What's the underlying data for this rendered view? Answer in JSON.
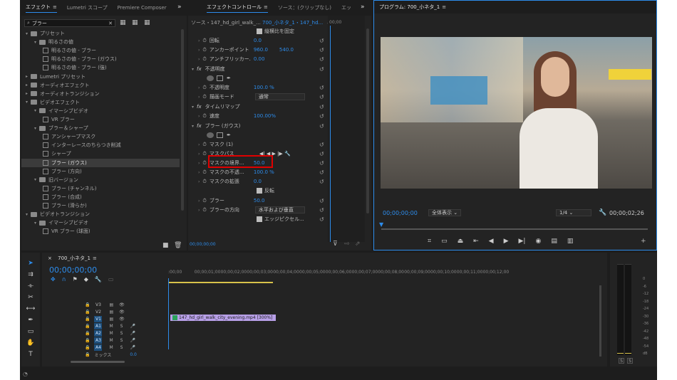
{
  "effects_panel": {
    "tab": "エフェクト",
    "tab2": "Lumetri スコープ",
    "tab3": "Premiere Composer",
    "search": "ブラー",
    "tree": [
      {
        "label": "プリセット",
        "lvl": 0,
        "type": "folder",
        "open": true
      },
      {
        "label": "明るさの値",
        "lvl": 1,
        "type": "folder",
        "open": true
      },
      {
        "label": "明るさの値 - ブラー",
        "lvl": 2,
        "type": "fx"
      },
      {
        "label": "明るさの値 - ブラー (ガウス)",
        "lvl": 2,
        "type": "fx"
      },
      {
        "label": "明るさの値 - ブラー (強)",
        "lvl": 2,
        "type": "fx"
      },
      {
        "label": "Lumetri プリセット",
        "lvl": 0,
        "type": "folder",
        "open": false
      },
      {
        "label": "オーディオエフェクト",
        "lvl": 0,
        "type": "folder",
        "open": false
      },
      {
        "label": "オーディオトランジション",
        "lvl": 0,
        "type": "folder",
        "open": false
      },
      {
        "label": "ビデオエフェクト",
        "lvl": 0,
        "type": "folder",
        "open": true
      },
      {
        "label": "イマーシブビデオ",
        "lvl": 1,
        "type": "folder",
        "open": true
      },
      {
        "label": "VR ブラー",
        "lvl": 2,
        "type": "fx"
      },
      {
        "label": "ブラー＆シャープ",
        "lvl": 1,
        "type": "folder",
        "open": true
      },
      {
        "label": "アンシャープマスク",
        "lvl": 2,
        "type": "fx"
      },
      {
        "label": "インターレースのちらつき削減",
        "lvl": 2,
        "type": "fx"
      },
      {
        "label": "シャープ",
        "lvl": 2,
        "type": "fx"
      },
      {
        "label": "ブラー (ガウス)",
        "lvl": 2,
        "type": "fx",
        "selected": true
      },
      {
        "label": "ブラー (方向)",
        "lvl": 2,
        "type": "fx"
      },
      {
        "label": "旧バージョン",
        "lvl": 1,
        "type": "folder",
        "open": true
      },
      {
        "label": "ブラー (チャンネル)",
        "lvl": 2,
        "type": "fx"
      },
      {
        "label": "ブラー (合成)",
        "lvl": 2,
        "type": "fx"
      },
      {
        "label": "ブラー (滑らか)",
        "lvl": 2,
        "type": "fx"
      },
      {
        "label": "ビデオトランジション",
        "lvl": 0,
        "type": "folder",
        "open": true
      },
      {
        "label": "イマーシブビデオ",
        "lvl": 1,
        "type": "folder",
        "open": true
      },
      {
        "label": "VR ブラー (球面)",
        "lvl": 2,
        "type": "fx"
      }
    ]
  },
  "effect_controls": {
    "tab": "エフェクトコントロール",
    "tab2": "ソース：(クリップなし)",
    "tab3": "エッ",
    "source": "ソース・147_hd_girl_walk_...",
    "clip": "700_小ネタ_1・147_hd...",
    "timecode": "00;00;00;00",
    "ruler": "00;00",
    "rows": [
      {
        "label": "縦横比を固定",
        "val": "",
        "kind": "check"
      },
      {
        "label": "回転",
        "val": "0.0"
      },
      {
        "label": "アンカーポイント",
        "val": "960.0",
        "val2": "540.0"
      },
      {
        "label": "アンチフリッカー...",
        "val": "0.00"
      },
      {
        "label": "不透明度",
        "val": "",
        "kind": "section"
      },
      {
        "label": "",
        "val": "",
        "kind": "shapes"
      },
      {
        "label": "不透明度",
        "val": "100.0 %"
      },
      {
        "label": "描画モード",
        "val": "通常",
        "kind": "drop"
      },
      {
        "label": "タイムリマップ",
        "val": "",
        "kind": "section"
      },
      {
        "label": "速度",
        "val": "100.00%"
      },
      {
        "label": "ブラー (ガウス)",
        "val": "",
        "kind": "section"
      },
      {
        "label": "",
        "val": "",
        "kind": "shapes"
      },
      {
        "label": "マスク (1)",
        "val": ""
      },
      {
        "label": "マスクパス",
        "val": "",
        "kind": "maskpath"
      },
      {
        "label": "マスクの境界...",
        "val": "50.0",
        "kind": "hl"
      },
      {
        "label": "マスクの不透...",
        "val": "100.0 %"
      },
      {
        "label": "マスクの拡張",
        "val": "0.0"
      },
      {
        "label": "反転",
        "val": "",
        "kind": "check"
      },
      {
        "label": "ブラー",
        "val": "50.0"
      },
      {
        "label": "ブラーの方向",
        "val": "水平および垂直",
        "kind": "drop"
      },
      {
        "label": "エッジピクセル...",
        "val": "",
        "kind": "check2"
      }
    ]
  },
  "program": {
    "title": "プログラム: 700_小ネタ_1",
    "timecode": "00;00;00;00",
    "fit": "全体表示",
    "quality": "1/4",
    "duration": "00;00;02;26"
  },
  "timeline": {
    "seq": "700_小ネタ_1",
    "timecode": "00;00;00;00",
    "ruler": [
      ":00;00",
      "00;00;01;00",
      "00;00;02;00",
      "00;00;03;00",
      "00;00;04;00",
      "00;00;05;00",
      "00;00;06;00",
      "00;00;07;00",
      "00;00;08;00",
      "00;00;09;00",
      "00;00;10;00",
      "00;00;11;00",
      "00;00;12;00"
    ],
    "tracks": [
      "V3",
      "V2",
      "V1",
      "A1",
      "A2",
      "A3",
      "A4"
    ],
    "mix": "ミックス",
    "mix_val": "0.0",
    "clip": "147_hd_girl_walk_city_evening.mp4 [300%]",
    "meter": [
      "0",
      "-6",
      "-12",
      "-18",
      "-24",
      "-30",
      "-36",
      "-42",
      "-48",
      "-54",
      "dB"
    ],
    "solo": "S"
  }
}
